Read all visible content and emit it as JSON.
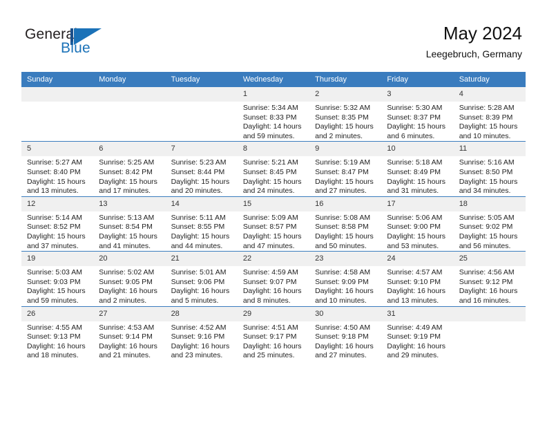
{
  "brand": {
    "name_top": "General",
    "name_bottom": "Blue",
    "accent_color": "#1b72b8",
    "mark_color": "#1b4f8a"
  },
  "header": {
    "title": "May 2024",
    "subtitle": "Leegebruch, Germany"
  },
  "theme": {
    "header_row_bg": "#3a7cbe",
    "day_number_bg": "#f0f0f0",
    "grid_line": "#3a7cbe",
    "text": "#222222"
  },
  "weekday_headers": [
    "Sunday",
    "Monday",
    "Tuesday",
    "Wednesday",
    "Thursday",
    "Friday",
    "Saturday"
  ],
  "weeks": [
    [
      {
        "day": "",
        "empty": true,
        "sunrise": "",
        "sunset": "",
        "daylight": ""
      },
      {
        "day": "",
        "empty": true,
        "sunrise": "",
        "sunset": "",
        "daylight": ""
      },
      {
        "day": "",
        "empty": true,
        "sunrise": "",
        "sunset": "",
        "daylight": ""
      },
      {
        "day": "1",
        "empty": false,
        "sunrise": "Sunrise: 5:34 AM",
        "sunset": "Sunset: 8:33 PM",
        "daylight": "Daylight: 14 hours and 59 minutes."
      },
      {
        "day": "2",
        "empty": false,
        "sunrise": "Sunrise: 5:32 AM",
        "sunset": "Sunset: 8:35 PM",
        "daylight": "Daylight: 15 hours and 2 minutes."
      },
      {
        "day": "3",
        "empty": false,
        "sunrise": "Sunrise: 5:30 AM",
        "sunset": "Sunset: 8:37 PM",
        "daylight": "Daylight: 15 hours and 6 minutes."
      },
      {
        "day": "4",
        "empty": false,
        "sunrise": "Sunrise: 5:28 AM",
        "sunset": "Sunset: 8:39 PM",
        "daylight": "Daylight: 15 hours and 10 minutes."
      }
    ],
    [
      {
        "day": "5",
        "empty": false,
        "sunrise": "Sunrise: 5:27 AM",
        "sunset": "Sunset: 8:40 PM",
        "daylight": "Daylight: 15 hours and 13 minutes."
      },
      {
        "day": "6",
        "empty": false,
        "sunrise": "Sunrise: 5:25 AM",
        "sunset": "Sunset: 8:42 PM",
        "daylight": "Daylight: 15 hours and 17 minutes."
      },
      {
        "day": "7",
        "empty": false,
        "sunrise": "Sunrise: 5:23 AM",
        "sunset": "Sunset: 8:44 PM",
        "daylight": "Daylight: 15 hours and 20 minutes."
      },
      {
        "day": "8",
        "empty": false,
        "sunrise": "Sunrise: 5:21 AM",
        "sunset": "Sunset: 8:45 PM",
        "daylight": "Daylight: 15 hours and 24 minutes."
      },
      {
        "day": "9",
        "empty": false,
        "sunrise": "Sunrise: 5:19 AM",
        "sunset": "Sunset: 8:47 PM",
        "daylight": "Daylight: 15 hours and 27 minutes."
      },
      {
        "day": "10",
        "empty": false,
        "sunrise": "Sunrise: 5:18 AM",
        "sunset": "Sunset: 8:49 PM",
        "daylight": "Daylight: 15 hours and 31 minutes."
      },
      {
        "day": "11",
        "empty": false,
        "sunrise": "Sunrise: 5:16 AM",
        "sunset": "Sunset: 8:50 PM",
        "daylight": "Daylight: 15 hours and 34 minutes."
      }
    ],
    [
      {
        "day": "12",
        "empty": false,
        "sunrise": "Sunrise: 5:14 AM",
        "sunset": "Sunset: 8:52 PM",
        "daylight": "Daylight: 15 hours and 37 minutes."
      },
      {
        "day": "13",
        "empty": false,
        "sunrise": "Sunrise: 5:13 AM",
        "sunset": "Sunset: 8:54 PM",
        "daylight": "Daylight: 15 hours and 41 minutes."
      },
      {
        "day": "14",
        "empty": false,
        "sunrise": "Sunrise: 5:11 AM",
        "sunset": "Sunset: 8:55 PM",
        "daylight": "Daylight: 15 hours and 44 minutes."
      },
      {
        "day": "15",
        "empty": false,
        "sunrise": "Sunrise: 5:09 AM",
        "sunset": "Sunset: 8:57 PM",
        "daylight": "Daylight: 15 hours and 47 minutes."
      },
      {
        "day": "16",
        "empty": false,
        "sunrise": "Sunrise: 5:08 AM",
        "sunset": "Sunset: 8:58 PM",
        "daylight": "Daylight: 15 hours and 50 minutes."
      },
      {
        "day": "17",
        "empty": false,
        "sunrise": "Sunrise: 5:06 AM",
        "sunset": "Sunset: 9:00 PM",
        "daylight": "Daylight: 15 hours and 53 minutes."
      },
      {
        "day": "18",
        "empty": false,
        "sunrise": "Sunrise: 5:05 AM",
        "sunset": "Sunset: 9:02 PM",
        "daylight": "Daylight: 15 hours and 56 minutes."
      }
    ],
    [
      {
        "day": "19",
        "empty": false,
        "sunrise": "Sunrise: 5:03 AM",
        "sunset": "Sunset: 9:03 PM",
        "daylight": "Daylight: 15 hours and 59 minutes."
      },
      {
        "day": "20",
        "empty": false,
        "sunrise": "Sunrise: 5:02 AM",
        "sunset": "Sunset: 9:05 PM",
        "daylight": "Daylight: 16 hours and 2 minutes."
      },
      {
        "day": "21",
        "empty": false,
        "sunrise": "Sunrise: 5:01 AM",
        "sunset": "Sunset: 9:06 PM",
        "daylight": "Daylight: 16 hours and 5 minutes."
      },
      {
        "day": "22",
        "empty": false,
        "sunrise": "Sunrise: 4:59 AM",
        "sunset": "Sunset: 9:07 PM",
        "daylight": "Daylight: 16 hours and 8 minutes."
      },
      {
        "day": "23",
        "empty": false,
        "sunrise": "Sunrise: 4:58 AM",
        "sunset": "Sunset: 9:09 PM",
        "daylight": "Daylight: 16 hours and 10 minutes."
      },
      {
        "day": "24",
        "empty": false,
        "sunrise": "Sunrise: 4:57 AM",
        "sunset": "Sunset: 9:10 PM",
        "daylight": "Daylight: 16 hours and 13 minutes."
      },
      {
        "day": "25",
        "empty": false,
        "sunrise": "Sunrise: 4:56 AM",
        "sunset": "Sunset: 9:12 PM",
        "daylight": "Daylight: 16 hours and 16 minutes."
      }
    ],
    [
      {
        "day": "26",
        "empty": false,
        "sunrise": "Sunrise: 4:55 AM",
        "sunset": "Sunset: 9:13 PM",
        "daylight": "Daylight: 16 hours and 18 minutes."
      },
      {
        "day": "27",
        "empty": false,
        "sunrise": "Sunrise: 4:53 AM",
        "sunset": "Sunset: 9:14 PM",
        "daylight": "Daylight: 16 hours and 21 minutes."
      },
      {
        "day": "28",
        "empty": false,
        "sunrise": "Sunrise: 4:52 AM",
        "sunset": "Sunset: 9:16 PM",
        "daylight": "Daylight: 16 hours and 23 minutes."
      },
      {
        "day": "29",
        "empty": false,
        "sunrise": "Sunrise: 4:51 AM",
        "sunset": "Sunset: 9:17 PM",
        "daylight": "Daylight: 16 hours and 25 minutes."
      },
      {
        "day": "30",
        "empty": false,
        "sunrise": "Sunrise: 4:50 AM",
        "sunset": "Sunset: 9:18 PM",
        "daylight": "Daylight: 16 hours and 27 minutes."
      },
      {
        "day": "31",
        "empty": false,
        "sunrise": "Sunrise: 4:49 AM",
        "sunset": "Sunset: 9:19 PM",
        "daylight": "Daylight: 16 hours and 29 minutes."
      },
      {
        "day": "",
        "empty": true,
        "sunrise": "",
        "sunset": "",
        "daylight": ""
      }
    ]
  ]
}
